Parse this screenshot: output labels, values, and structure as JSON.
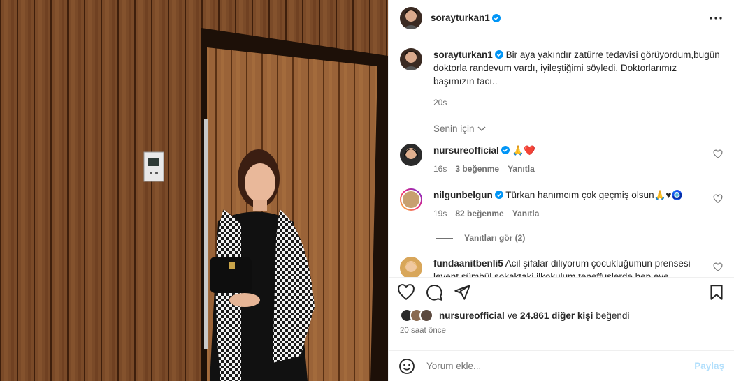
{
  "post": {
    "username": "sorayturkan1",
    "caption": "Bir aya yakındır zatürre tedavisi görüyordum,bugün doktorla randevum vardı, iyileştiğimi söyledi. Doktorlarımız başımızın tacı..",
    "time": "20s",
    "for_you": "Senin için",
    "likes_count": "24.861",
    "likes_text_mid": "ve",
    "likes_text_tail": "diğer kişi",
    "likes_text_end": "beğendi",
    "liked_by": "nursureofficial",
    "posted_ago": "20 saat önce"
  },
  "comments": [
    {
      "username": "nursureofficial",
      "text": "🙏❤️",
      "time": "16s",
      "likes": "3 beğenme",
      "reply": "Yanıtla"
    },
    {
      "username": "nilgunbelgun",
      "text": "Türkan hanımcım çok geçmiş olsun🙏♥🧿",
      "time": "19s",
      "likes": "82 beğenme",
      "reply": "Yanıtla"
    },
    {
      "username": "fundaanitbenli5",
      "text": "Acil şifalar diliyorum çocukluğumun prensesi levent sümbül sokaktaki ilkokulum teneffuslerde hep eve",
      "time": "",
      "likes": "",
      "reply": ""
    }
  ],
  "view_replies": "Yanıtları gör (2)",
  "add_comment": {
    "placeholder": "Yorum ekle...",
    "post_label": "Paylaş"
  },
  "colors": {
    "verified": "#0095f6",
    "muted": "#737373",
    "post_disabled": "#b2dffc",
    "heart_red": "#ed4956"
  },
  "icons": [
    "more-icon",
    "verified-icon",
    "heart-icon",
    "comment-icon",
    "share-icon",
    "save-icon",
    "emoji-icon",
    "chevron-down-icon"
  ]
}
